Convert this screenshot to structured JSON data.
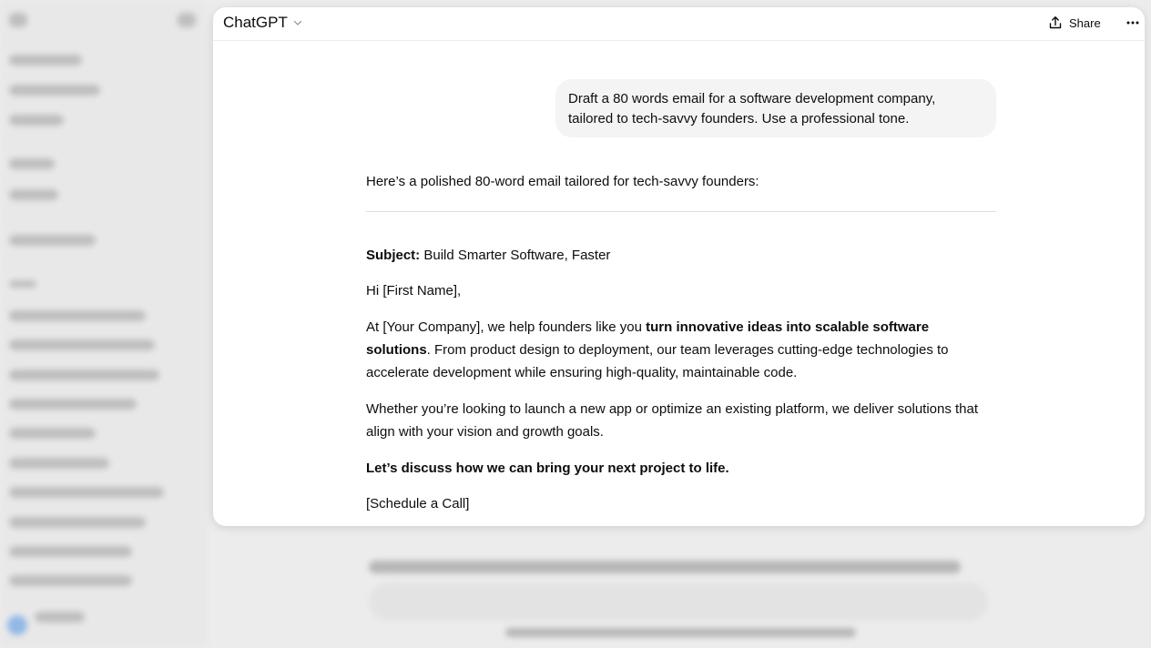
{
  "header": {
    "model_label": "ChatGPT",
    "share_label": "Share"
  },
  "conversation": {
    "user_message": "Draft a 80 words email for a software development company, tailored to tech-savvy founders. Use a professional tone.",
    "assistant": {
      "intro": "Here’s a polished 80-word email tailored for tech-savvy founders:",
      "subject_label": "Subject:",
      "subject_text": " Build Smarter Software, Faster",
      "greeting": "Hi [First Name],",
      "p1_before": "At [Your Company], we help founders like you ",
      "p1_bold": "turn innovative ideas into scalable software solutions",
      "p1_after": ". From product design to deployment, our team leverages cutting-edge technologies to accelerate development while ensuring high-quality, maintainable code.",
      "p2": "Whether you’re looking to launch a new app or optimize an existing platform, we deliver solutions that align with your vision and growth goals.",
      "p3": "Let’s discuss how we can bring your next project to life.",
      "cta": "[Schedule a Call]"
    }
  },
  "icons": {
    "model_dropdown": "chevron-down-icon",
    "share": "share-icon",
    "more": "more-horizontal-icon"
  }
}
